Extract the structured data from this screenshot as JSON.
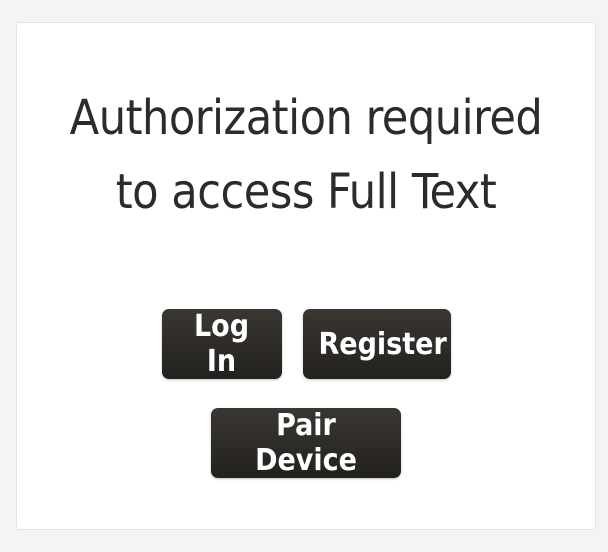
{
  "title": {
    "line1": "Authorization required",
    "line2": "to access Full Text"
  },
  "buttons": {
    "login": "Log In",
    "register": "Register",
    "pair_device": "Pair Device"
  },
  "colors": {
    "page_background": "#f4f4f4",
    "card_background": "#ffffff",
    "button_background": "#2b2926",
    "button_text": "#ffffff",
    "title_text": "#2b2b2b"
  }
}
